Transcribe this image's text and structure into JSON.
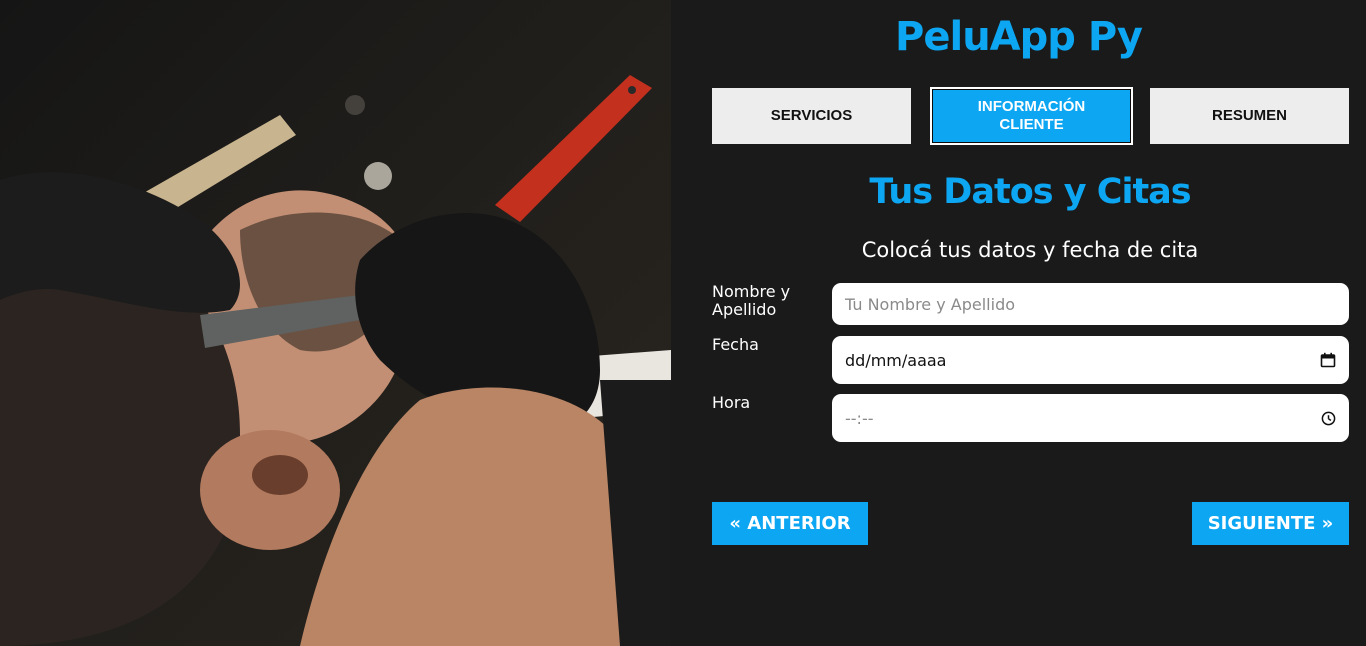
{
  "photo": {
    "alt_icon": "barber-photo"
  },
  "app": {
    "title": "PeluApp Py",
    "tabs": [
      {
        "label": "SERVICIOS",
        "active": false
      },
      {
        "label": "INFORMACIÓN CLIENTE",
        "active": true
      },
      {
        "label": "RESUMEN",
        "active": false
      }
    ],
    "section_title": "Tus Datos y Citas",
    "section_subtitle": "Colocá tus datos y fecha de cita",
    "form": {
      "name_label": "Nombre y Apellido",
      "name_placeholder": "Tu Nombre y Apellido",
      "date_label": "Fecha",
      "date_value": "dd/mm/aaaa",
      "time_label": "Hora",
      "time_value": "--:--"
    },
    "buttons": {
      "prev": "« ANTERIOR",
      "next": "SIGUIENTE »"
    },
    "colors": {
      "accent": "#0da6f2",
      "background": "#1a1a1a",
      "tab_inactive": "#ededed"
    }
  }
}
